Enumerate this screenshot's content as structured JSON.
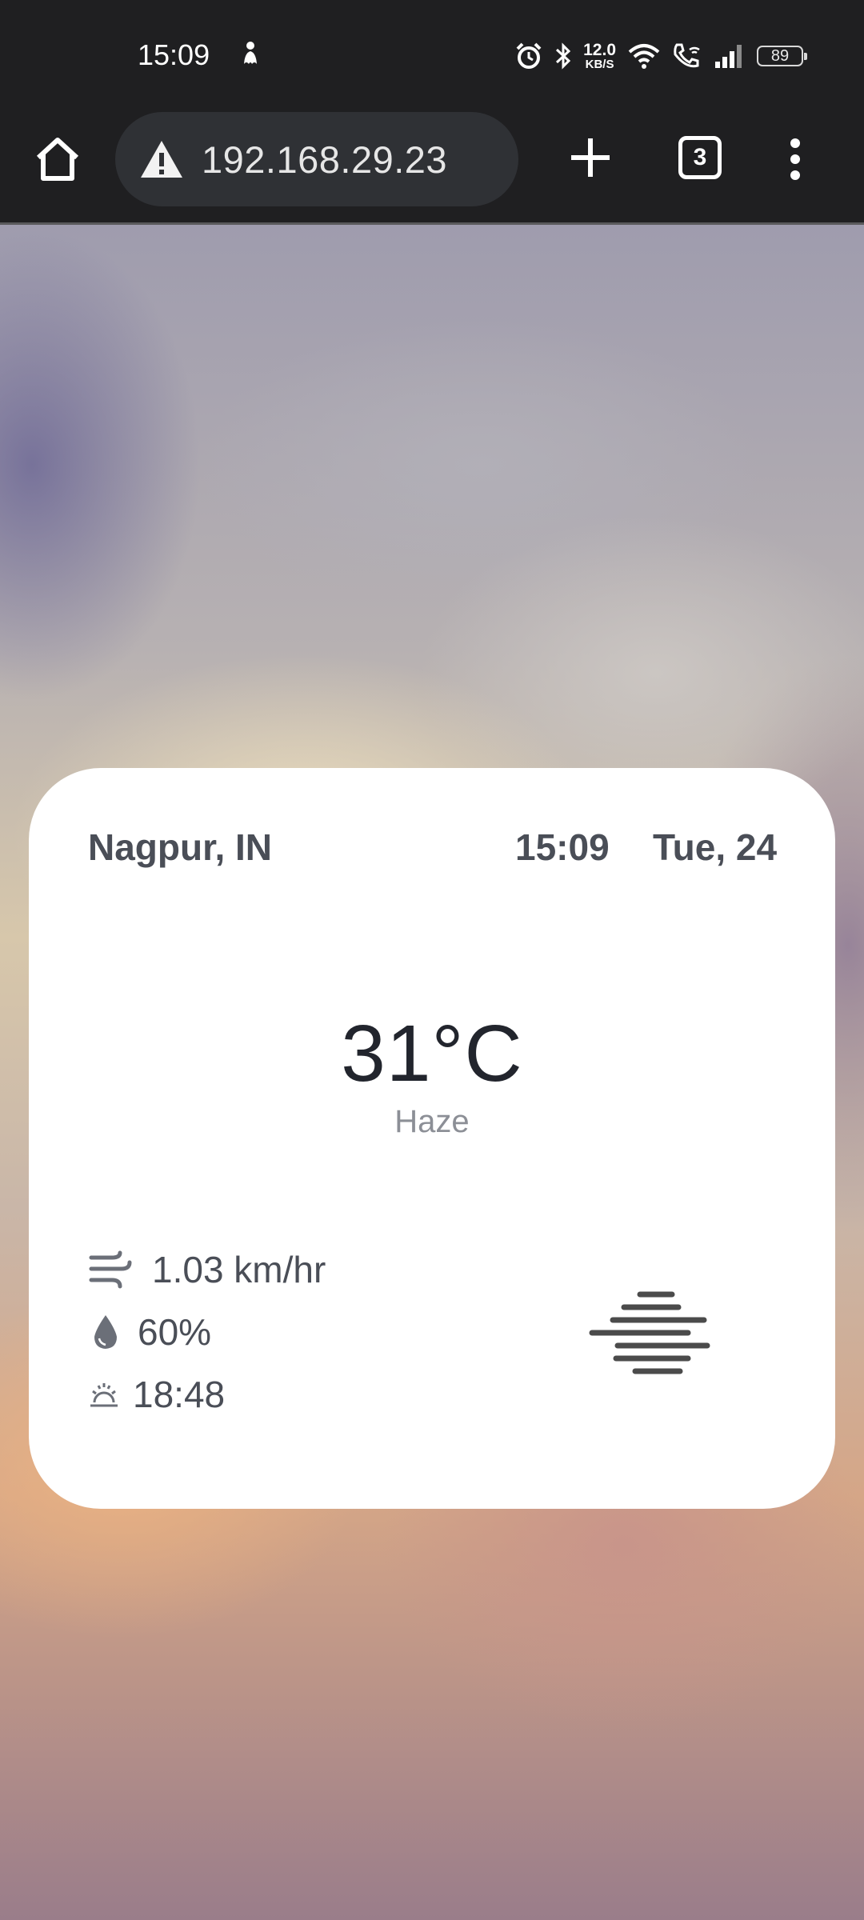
{
  "status_bar": {
    "time": "15:09",
    "net_speed_value": "12.0",
    "net_speed_unit": "KB/S",
    "battery": "89",
    "icons": [
      "notification-icon",
      "alarm-icon",
      "bluetooth-icon",
      "wifi-icon",
      "wifi-call-icon",
      "signal-icon",
      "battery-icon"
    ]
  },
  "browser": {
    "url": "192.168.29.23",
    "tab_count": "3",
    "icons": [
      "home-icon",
      "warning-icon",
      "plus-icon",
      "more-vert-icon"
    ]
  },
  "weather": {
    "location": "Nagpur, IN",
    "time": "15:09",
    "date": "Tue, 24",
    "temperature": "31°C",
    "condition": "Haze",
    "wind": "1.03 km/hr",
    "humidity": "60%",
    "sunset": "18:48",
    "icons": [
      "wind-icon",
      "humidity-drop-icon",
      "sunset-icon",
      "haze-icon"
    ]
  },
  "colors": {
    "status_bg": "#1f1f21",
    "url_bar_bg": "#2f3135",
    "card_bg": "#ffffff",
    "card_text": "#4a4e57",
    "temp_text": "#22252d",
    "muted_text": "#8c8f96"
  }
}
